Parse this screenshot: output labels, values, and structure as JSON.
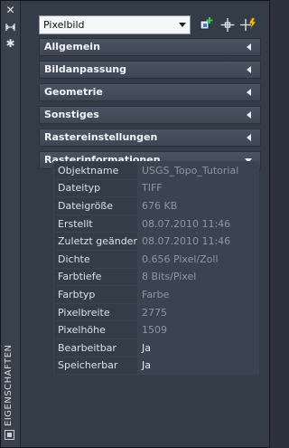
{
  "window": {
    "title": "EIGENSCHAFTEN"
  },
  "toolbar": {
    "selected_object": "Pixelbild"
  },
  "sections": [
    {
      "label": "Allgemein",
      "expanded": false
    },
    {
      "label": "Bildanpassung",
      "expanded": false
    },
    {
      "label": "Geometrie",
      "expanded": false
    },
    {
      "label": "Sonstiges",
      "expanded": false
    },
    {
      "label": "Rastereinstellungen",
      "expanded": false
    },
    {
      "label": "Rasterinformationen",
      "expanded": true
    }
  ],
  "properties": [
    {
      "key": "Objektname",
      "value": "USGS_Topo_Tutorial",
      "editable": false
    },
    {
      "key": "Dateityp",
      "value": "TIFF",
      "editable": false
    },
    {
      "key": "Dateigröße",
      "value": "676 KB",
      "editable": false
    },
    {
      "key": "Erstellt",
      "value": "08.07.2010 11:46",
      "editable": false
    },
    {
      "key": "Zuletzt geändert",
      "value": "08.07.2010 11:46",
      "editable": false
    },
    {
      "key": "Dichte",
      "value": "0.656 Pixel/Zoll",
      "editable": false
    },
    {
      "key": "Farbtiefe",
      "value": "8 Bits/Pixel",
      "editable": false
    },
    {
      "key": "Farbtyp",
      "value": "Farbe",
      "editable": false
    },
    {
      "key": "Pixelbreite",
      "value": "2775",
      "editable": false
    },
    {
      "key": "Pixelhöhe",
      "value": "1509",
      "editable": false
    },
    {
      "key": "Bearbeitbar",
      "value": "Ja",
      "editable": true
    },
    {
      "key": "Speicherbar",
      "value": "Ja",
      "editable": true
    }
  ],
  "icons": {
    "close": "close-icon",
    "autohide": "autohide-icon",
    "settings": "settings-icon",
    "toggle_pickadd": "toggle-pickadd-icon",
    "select_objects": "select-objects-icon",
    "quick_select": "quick-select-icon"
  }
}
